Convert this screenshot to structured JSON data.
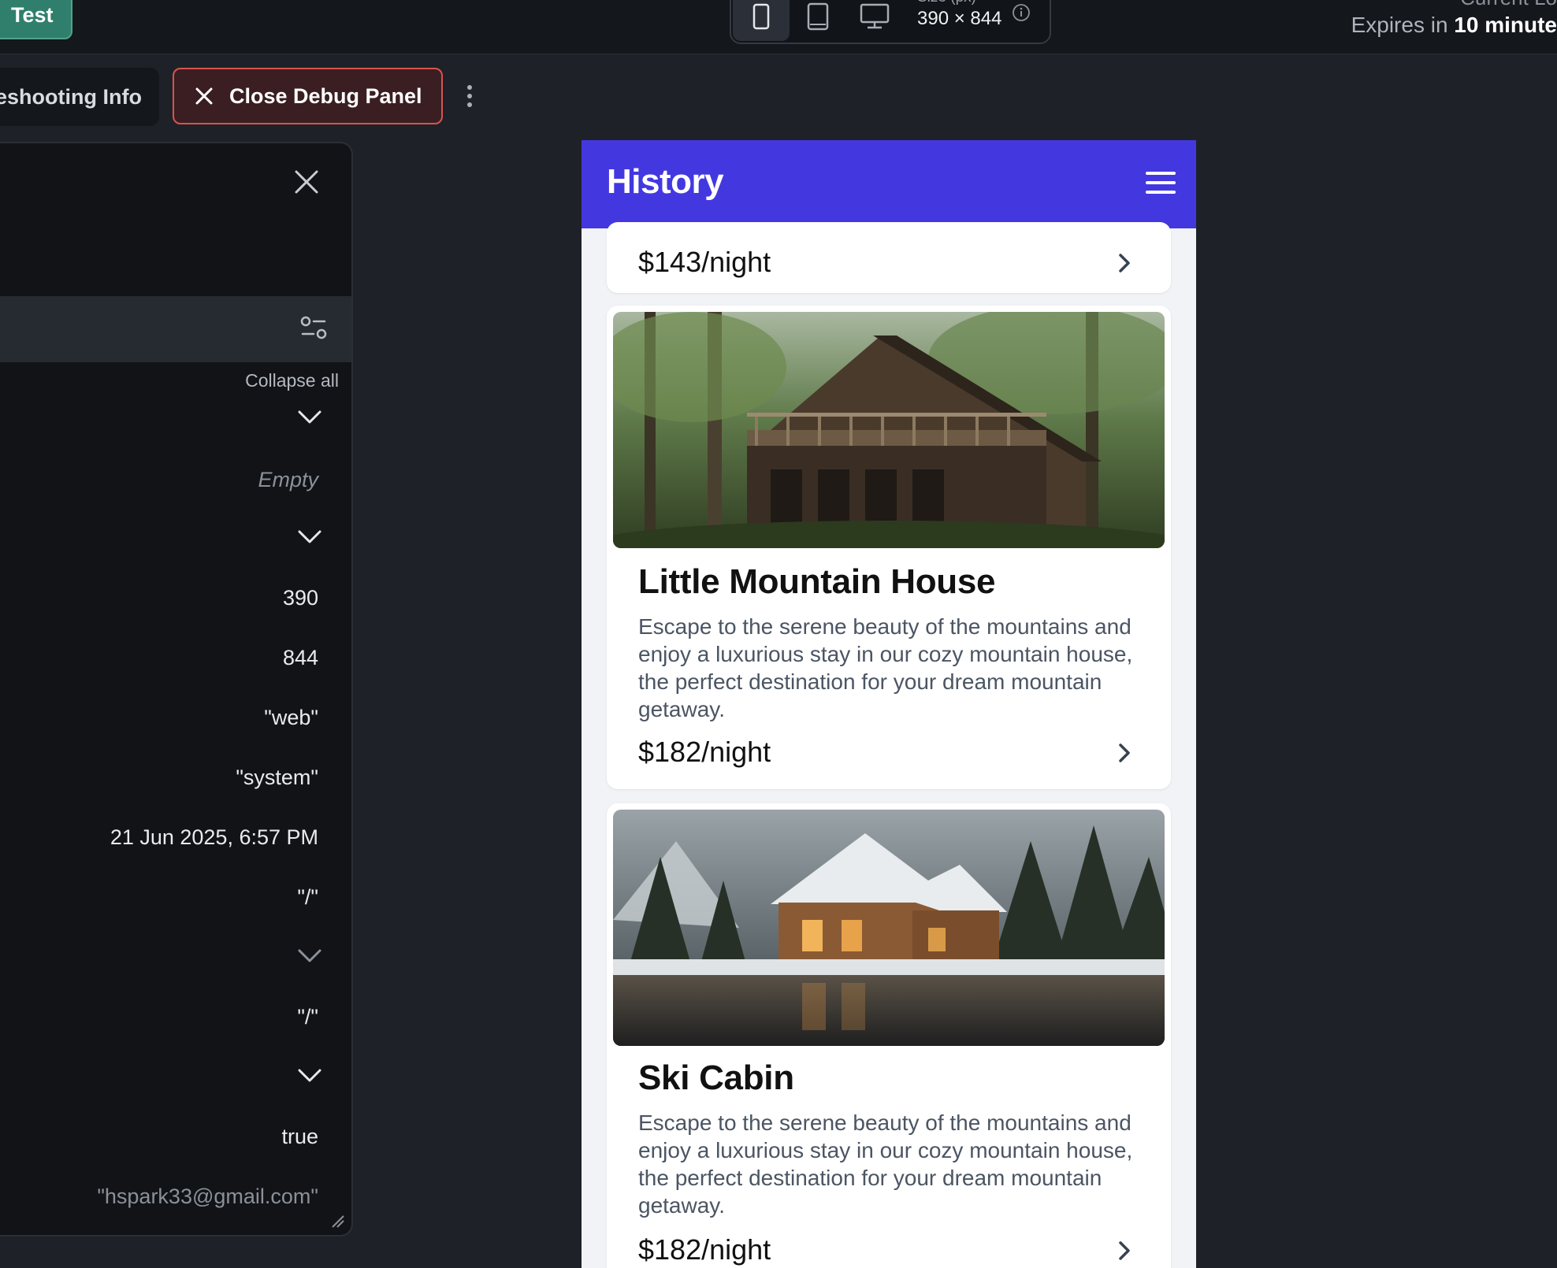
{
  "topbar": {
    "test_label": "Test",
    "size_label": "Size (px)",
    "size_value": "390 × 844",
    "current_label": "Current Lo",
    "expires_prefix": "Expires in ",
    "expires_value": "10 minute"
  },
  "toolbar": {
    "troubleshooting_label": "Troubleshooting Info",
    "close_debug_label": "Close Debug Panel"
  },
  "debug": {
    "collapse_all": "Collapse all",
    "rows": {
      "empty": "Empty",
      "width": "390",
      "height": "844",
      "platform": "\"web\"",
      "theme": "\"system\"",
      "datetime": "21 Jun 2025, 6:57 PM",
      "route1": "\"/\"",
      "route2": "\"/\"",
      "bool": "true",
      "email": "\"hspark33@gmail.com\""
    }
  },
  "app": {
    "title": "History",
    "cards": [
      {
        "price": "$143/night"
      },
      {
        "title": "Little Mountain House",
        "description": "Escape to the serene beauty of the mountains and enjoy a luxurious stay in our cozy mountain house, the perfect destination for your dream mountain getaway.",
        "price": "$182/night"
      },
      {
        "title": "Ski Cabin",
        "description": "Escape to the serene beauty of the mountains and enjoy a luxurious stay in our cozy mountain house, the perfect destination for your dream mountain getaway.",
        "price": "$182/night"
      }
    ]
  },
  "colors": {
    "app_header": "#4338e0",
    "close_debug_border": "#d9534f",
    "test_button": "#2f7f6c"
  }
}
